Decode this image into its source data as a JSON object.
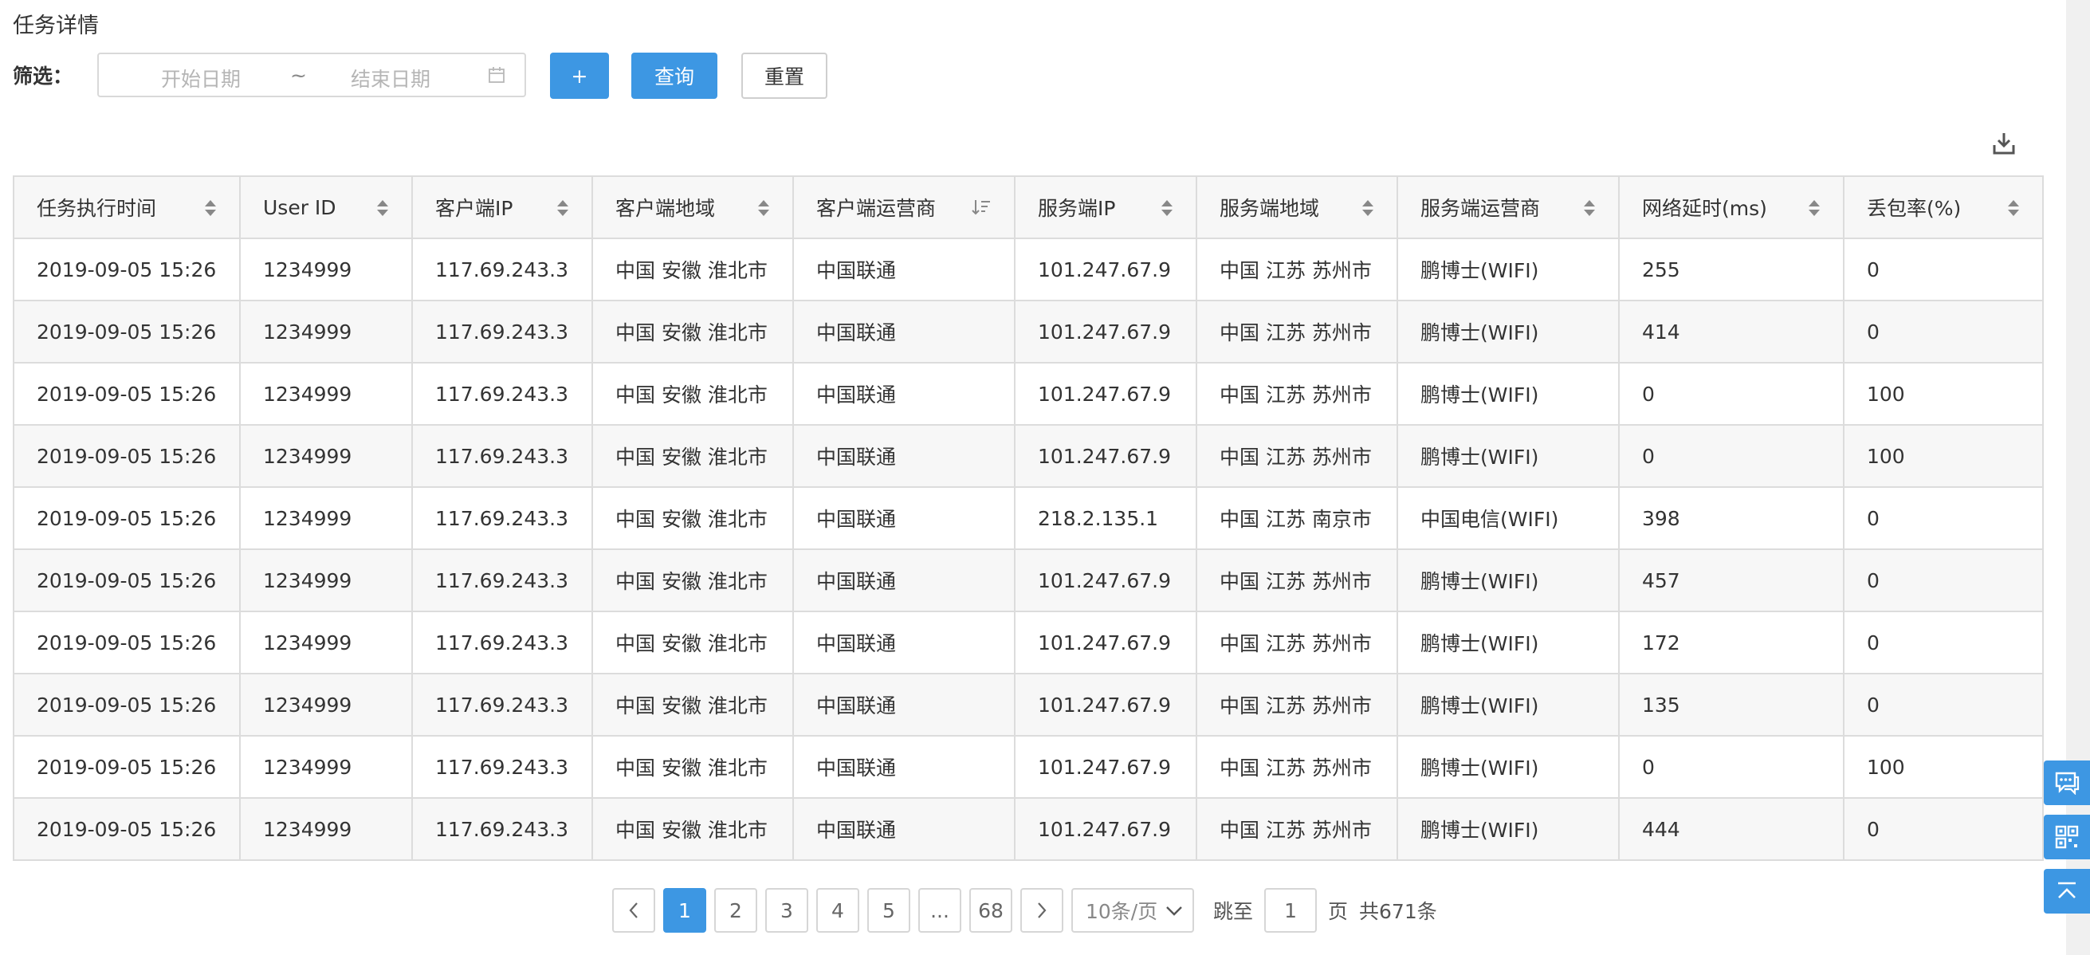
{
  "page": {
    "title": "任务详情"
  },
  "filter": {
    "label": "筛选：",
    "start_placeholder": "开始日期",
    "separator": "~",
    "end_placeholder": "结束日期",
    "add_label": "+",
    "query_label": "查询",
    "reset_label": "重置"
  },
  "table": {
    "columns": [
      "任务执行时间",
      "User ID",
      "客户端IP",
      "客户端地域",
      "客户端运营商",
      "服务端IP",
      "服务端地域",
      "服务端运营商",
      "网络延时(ms)",
      "丢包率(%)"
    ],
    "rows": [
      [
        "2019-09-05 15:26",
        "1234999",
        "117.69.243.3",
        "中国 安徽 淮北市",
        "中国联通",
        "101.247.67.9",
        "中国 江苏 苏州市",
        "鹏博士(WIFI)",
        "255",
        "0"
      ],
      [
        "2019-09-05 15:26",
        "1234999",
        "117.69.243.3",
        "中国 安徽 淮北市",
        "中国联通",
        "101.247.67.9",
        "中国 江苏 苏州市",
        "鹏博士(WIFI)",
        "414",
        "0"
      ],
      [
        "2019-09-05 15:26",
        "1234999",
        "117.69.243.3",
        "中国 安徽 淮北市",
        "中国联通",
        "101.247.67.9",
        "中国 江苏 苏州市",
        "鹏博士(WIFI)",
        "0",
        "100"
      ],
      [
        "2019-09-05 15:26",
        "1234999",
        "117.69.243.3",
        "中国 安徽 淮北市",
        "中国联通",
        "101.247.67.9",
        "中国 江苏 苏州市",
        "鹏博士(WIFI)",
        "0",
        "100"
      ],
      [
        "2019-09-05 15:26",
        "1234999",
        "117.69.243.3",
        "中国 安徽 淮北市",
        "中国联通",
        "218.2.135.1",
        "中国 江苏 南京市",
        "中国电信(WIFI)",
        "398",
        "0"
      ],
      [
        "2019-09-05 15:26",
        "1234999",
        "117.69.243.3",
        "中国 安徽 淮北市",
        "中国联通",
        "101.247.67.9",
        "中国 江苏 苏州市",
        "鹏博士(WIFI)",
        "457",
        "0"
      ],
      [
        "2019-09-05 15:26",
        "1234999",
        "117.69.243.3",
        "中国 安徽 淮北市",
        "中国联通",
        "101.247.67.9",
        "中国 江苏 苏州市",
        "鹏博士(WIFI)",
        "172",
        "0"
      ],
      [
        "2019-09-05 15:26",
        "1234999",
        "117.69.243.3",
        "中国 安徽 淮北市",
        "中国联通",
        "101.247.67.9",
        "中国 江苏 苏州市",
        "鹏博士(WIFI)",
        "135",
        "0"
      ],
      [
        "2019-09-05 15:26",
        "1234999",
        "117.69.243.3",
        "中国 安徽 淮北市",
        "中国联通",
        "101.247.67.9",
        "中国 江苏 苏州市",
        "鹏博士(WIFI)",
        "0",
        "100"
      ],
      [
        "2019-09-05 15:26",
        "1234999",
        "117.69.243.3",
        "中国 安徽 淮北市",
        "中国联通",
        "101.247.67.9",
        "中国 江苏 苏州市",
        "鹏博士(WIFI)",
        "444",
        "0"
      ]
    ]
  },
  "pagination": {
    "pages": [
      "1",
      "2",
      "3",
      "4",
      "5",
      "...",
      "68"
    ],
    "current": "1",
    "page_size": "10条/页",
    "jump_label": "跳至",
    "jump_value": "1",
    "page_unit": "页",
    "total": "共671条"
  },
  "icons": {
    "calendar": "calendar-icon",
    "export": "download-icon",
    "sort": "sort-icon",
    "sort_desc": "sort-descending-icon",
    "prev": "chevron-left-icon",
    "next": "chevron-right-icon",
    "dropdown": "chevron-down-icon",
    "chat": "chat-icon",
    "qrcode": "qrcode-icon",
    "back_top": "back-to-top-icon"
  },
  "colors": {
    "primary": "#3d97e3",
    "border": "#dcdcdc",
    "stripe": "#f7f7f7"
  }
}
